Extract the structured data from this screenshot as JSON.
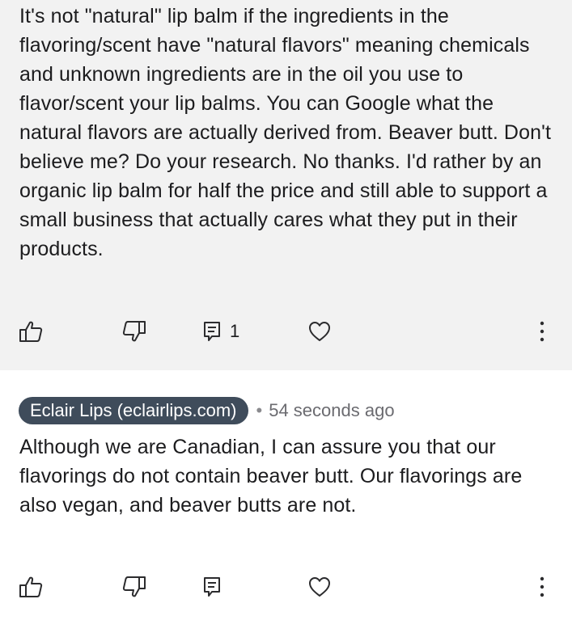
{
  "comments": [
    {
      "text": "It's not \"natural\" lip balm if the ingredients in the flavoring/scent have \"natural flavors\" meaning chemicals and unknown ingredients are in the oil you use to flavor/scent your lip balms. You can Google what the natural flavors are actually derived from. Beaver butt. Don't believe me? Do your research. No thanks. I'd rather by an organic lip balm for half the price and still able to support a small business that actually cares what they put in their products.",
      "reply_count": "1",
      "background": "#f2f2f2"
    },
    {
      "author": "Eclair Lips (eclairlips.com)",
      "separator": "•",
      "timestamp": "54 seconds ago",
      "text": "Although we are Canadian, I can assure you that our flavorings do not contain beaver butt. Our flavorings are also vegan, and beaver butts are not.",
      "reply_count": "",
      "background": "#ffffff"
    }
  ],
  "icons": {
    "like": "thumbs-up-icon",
    "dislike": "thumbs-down-icon",
    "reply": "reply-icon",
    "heart": "heart-icon",
    "more": "more-vertical-icon"
  },
  "colors": {
    "author_badge": "#3f4c5b",
    "text": "#1c1c1e",
    "meta": "#6b6b70"
  }
}
